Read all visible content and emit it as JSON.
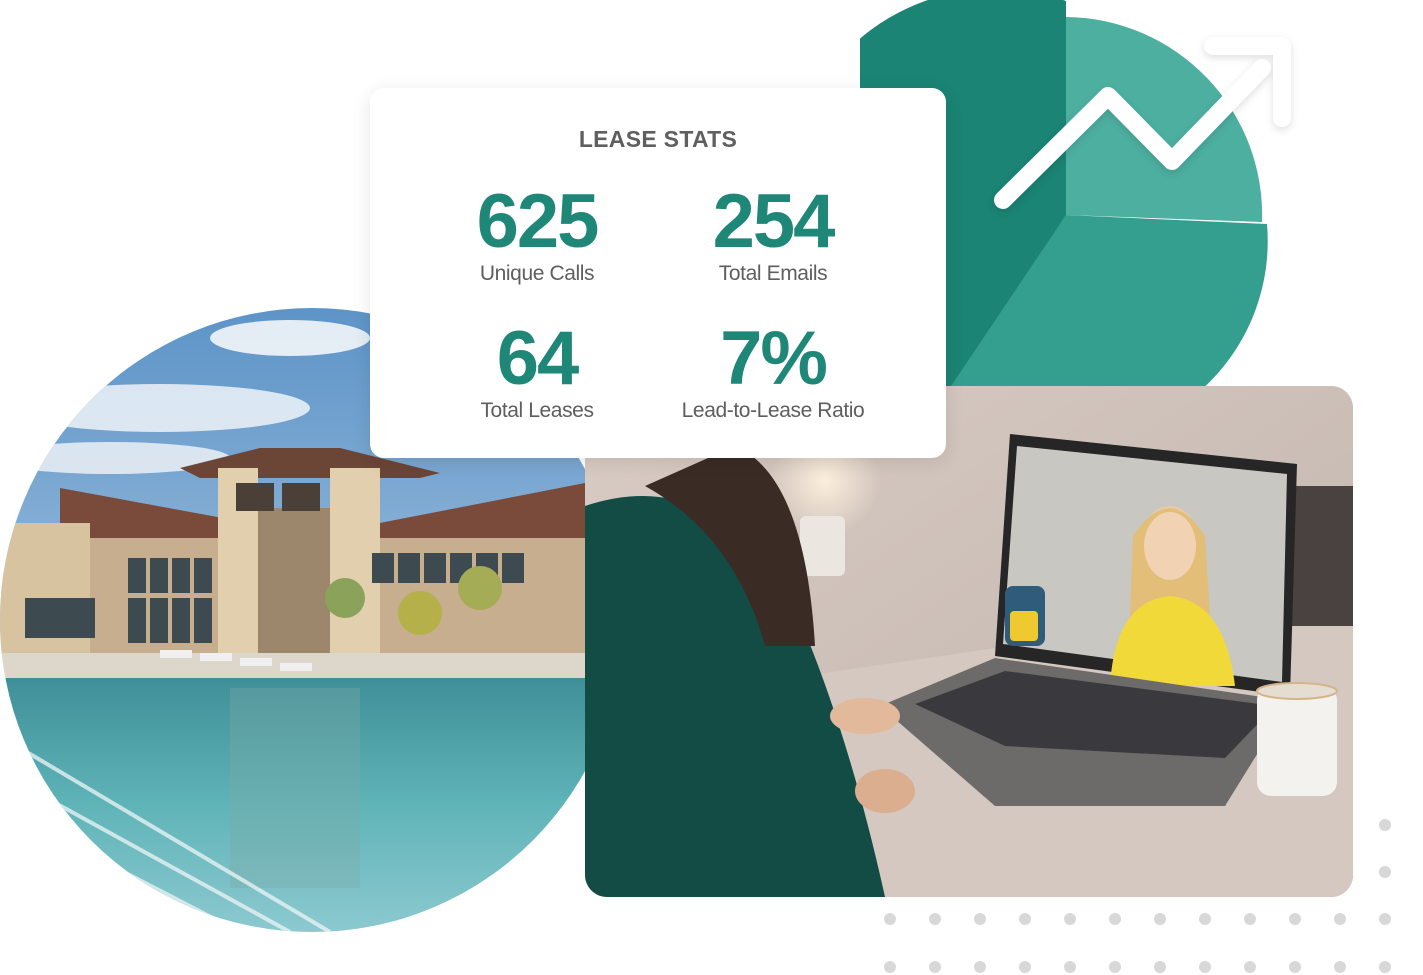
{
  "card": {
    "title": "LEASE STATS",
    "stats": [
      {
        "value": "625",
        "label": "Unique Calls"
      },
      {
        "value": "254",
        "label": "Total Emails"
      },
      {
        "value": "64",
        "label": "Total Leases"
      },
      {
        "value": "7%",
        "label": "Lead-to-Lease Ratio"
      }
    ]
  },
  "colors": {
    "accent": "#1e8778",
    "pie_dark": "#1b8474",
    "pie_light": "#4dafa0",
    "pie_mid": "#349f8f",
    "label_gray": "#5e5e5e",
    "dots": "#d8d8d8"
  },
  "images": {
    "pool": "resort-pool-clubhouse-photo",
    "laptop": "video-call-laptop-photo"
  },
  "icons": {
    "trend": "trending-up-arrow-icon",
    "pie": "pie-chart-icon"
  }
}
